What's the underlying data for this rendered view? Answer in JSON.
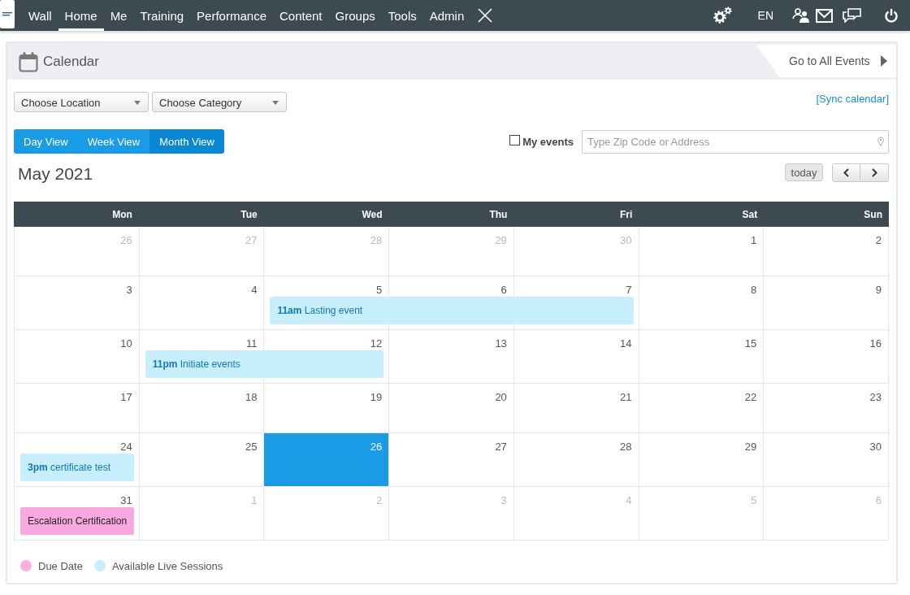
{
  "nav": {
    "items": [
      {
        "label": "Wall",
        "selected": false
      },
      {
        "label": "Home",
        "selected": true
      },
      {
        "label": "Me",
        "selected": false
      },
      {
        "label": "Training",
        "selected": false
      },
      {
        "label": "Performance",
        "selected": false
      },
      {
        "label": "Content",
        "selected": false
      },
      {
        "label": "Groups",
        "selected": false
      },
      {
        "label": "Tools",
        "selected": false
      },
      {
        "label": "Admin",
        "selected": false
      }
    ],
    "language": "EN"
  },
  "panel": {
    "title": "Calendar",
    "all_events_link": "Go to All Events"
  },
  "filters": {
    "location_select": "Choose Location",
    "category_select": "Choose Category",
    "sync_link": "[Sync calendar]"
  },
  "views": [
    {
      "label": "Day View",
      "selected": false
    },
    {
      "label": "Week View",
      "selected": false
    },
    {
      "label": "Month View",
      "selected": true
    }
  ],
  "my_events": {
    "label": "My events",
    "checked": false
  },
  "address": {
    "placeholder": "Type Zip Code or Address"
  },
  "month": {
    "title": "May 2021",
    "today_button": "today"
  },
  "weekdays": [
    "Mon",
    "Tue",
    "Wed",
    "Thu",
    "Fri",
    "Sat",
    "Sun"
  ],
  "weeks": [
    {
      "days": [
        {
          "label": "26",
          "outside_month": true,
          "today": false,
          "event_continues": false
        },
        {
          "label": "27",
          "outside_month": true,
          "today": false,
          "event_continues": false
        },
        {
          "label": "28",
          "outside_month": true,
          "today": false,
          "event_continues": false
        },
        {
          "label": "29",
          "outside_month": true,
          "today": false,
          "event_continues": false
        },
        {
          "label": "30",
          "outside_month": true,
          "today": false,
          "event_continues": false
        },
        {
          "label": "1",
          "outside_month": false,
          "today": false,
          "event_continues": false
        },
        {
          "label": "2",
          "outside_month": false,
          "today": false,
          "event_continues": false
        }
      ]
    },
    {
      "days": [
        {
          "label": "3",
          "outside_month": false,
          "today": false,
          "event_continues": false
        },
        {
          "label": "4",
          "outside_month": false,
          "today": false,
          "event_continues": false
        },
        {
          "label": "5",
          "outside_month": false,
          "today": false,
          "event_continues": false,
          "events": [
            {
              "kind": "session",
              "time": "11am",
              "title": "Lasting event",
              "color": "#c8effe"
            }
          ]
        },
        {
          "label": "6",
          "outside_month": false,
          "today": false,
          "event_continues": true
        },
        {
          "label": "7",
          "outside_month": false,
          "today": false,
          "event_continues": true
        },
        {
          "label": "8",
          "outside_month": false,
          "today": false,
          "event_continues": false
        },
        {
          "label": "9",
          "outside_month": false,
          "today": false,
          "event_continues": false
        }
      ]
    },
    {
      "days": [
        {
          "label": "10",
          "outside_month": false,
          "today": false,
          "event_continues": false
        },
        {
          "label": "11",
          "outside_month": false,
          "today": false,
          "event_continues": false,
          "events": [
            {
              "kind": "session",
              "time": "11pm",
              "title": "Initiate events",
              "color": "#c8effe"
            }
          ]
        },
        {
          "label": "12",
          "outside_month": false,
          "today": false,
          "event_continues": true
        },
        {
          "label": "13",
          "outside_month": false,
          "today": false,
          "event_continues": false
        },
        {
          "label": "14",
          "outside_month": false,
          "today": false,
          "event_continues": false
        },
        {
          "label": "15",
          "outside_month": false,
          "today": false,
          "event_continues": false
        },
        {
          "label": "16",
          "outside_month": false,
          "today": false,
          "event_continues": false
        }
      ]
    },
    {
      "days": [
        {
          "label": "17",
          "outside_month": false,
          "today": false,
          "event_continues": false
        },
        {
          "label": "18",
          "outside_month": false,
          "today": false,
          "event_continues": false
        },
        {
          "label": "19",
          "outside_month": false,
          "today": false,
          "event_continues": false
        },
        {
          "label": "20",
          "outside_month": false,
          "today": false,
          "event_continues": false
        },
        {
          "label": "21",
          "outside_month": false,
          "today": false,
          "event_continues": false
        },
        {
          "label": "22",
          "outside_month": false,
          "today": false,
          "event_continues": false
        },
        {
          "label": "23",
          "outside_month": false,
          "today": false,
          "event_continues": false
        }
      ]
    },
    {
      "days": [
        {
          "label": "24",
          "outside_month": false,
          "today": false,
          "event_continues": false,
          "events": [
            {
              "kind": "session",
              "time": "3pm",
              "title": "certificate test",
              "color": "#c8effe"
            }
          ]
        },
        {
          "label": "25",
          "outside_month": false,
          "today": false,
          "event_continues": false
        },
        {
          "label": "26",
          "outside_month": false,
          "today": true,
          "event_continues": false
        },
        {
          "label": "27",
          "outside_month": false,
          "today": false,
          "event_continues": false
        },
        {
          "label": "28",
          "outside_month": false,
          "today": false,
          "event_continues": false
        },
        {
          "label": "29",
          "outside_month": false,
          "today": false,
          "event_continues": false
        },
        {
          "label": "30",
          "outside_month": false,
          "today": false,
          "event_continues": false
        }
      ]
    },
    {
      "days": [
        {
          "label": "31",
          "outside_month": false,
          "today": false,
          "event_continues": false,
          "events": [
            {
              "kind": "due",
              "title": "Escalation Certification",
              "color": "#f9a9df"
            }
          ]
        },
        {
          "label": "1",
          "outside_month": true,
          "today": false,
          "event_continues": false
        },
        {
          "label": "2",
          "outside_month": true,
          "today": false,
          "event_continues": false
        },
        {
          "label": "3",
          "outside_month": true,
          "today": false,
          "event_continues": false
        },
        {
          "label": "4",
          "outside_month": true,
          "today": false,
          "event_continues": false
        },
        {
          "label": "5",
          "outside_month": true,
          "today": false,
          "event_continues": false
        },
        {
          "label": "6",
          "outside_month": true,
          "today": false,
          "event_continues": false
        }
      ]
    }
  ],
  "legend": [
    {
      "label": "Due Date",
      "color": "#fbaee1"
    },
    {
      "label": "Available Live Sessions",
      "color": "#c9eefd"
    }
  ]
}
